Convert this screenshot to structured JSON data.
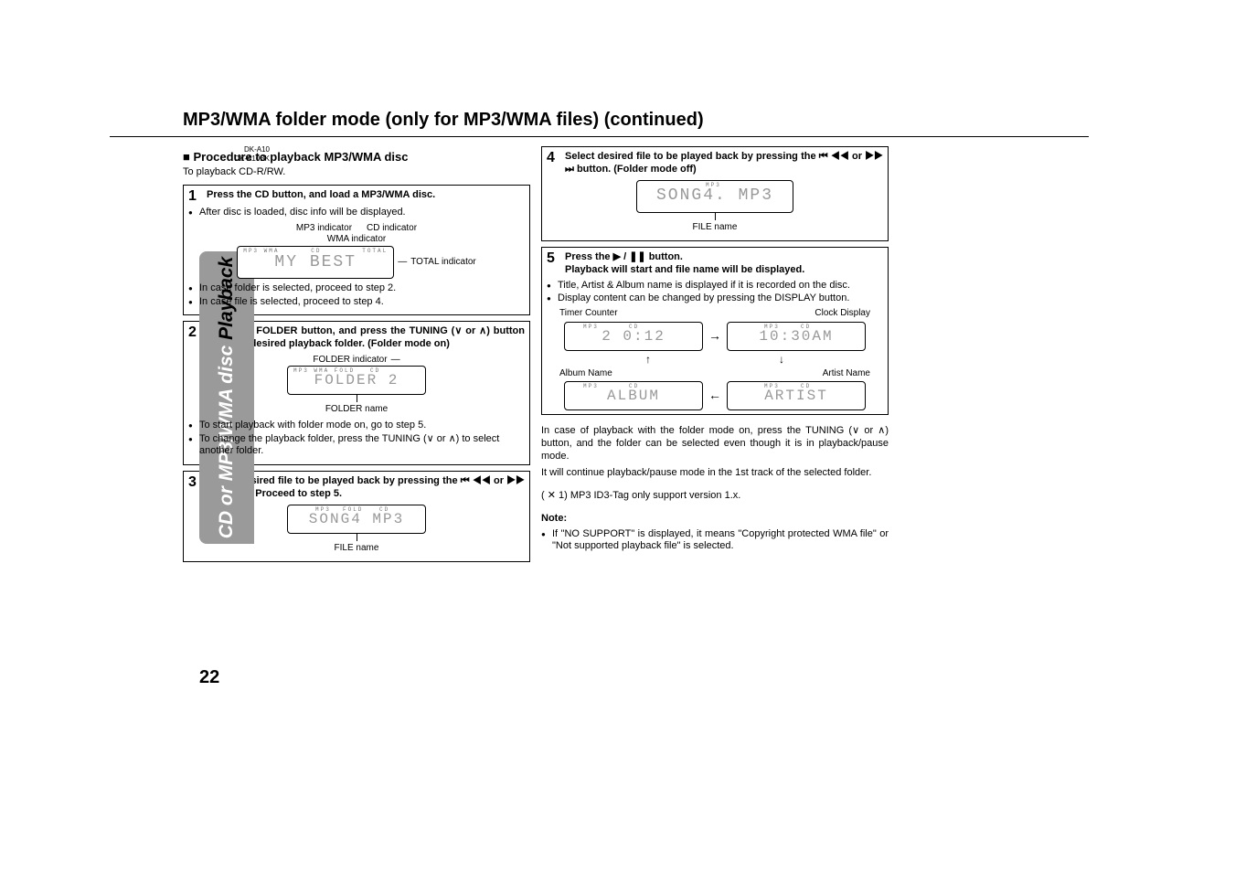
{
  "model": {
    "line1": "DK-A10",
    "line2": "DK-A10BK"
  },
  "title": "MP3/WMA folder mode (only for MP3/WMA files) (continued)",
  "tab": {
    "white": "CD or MP3/WMA disc ",
    "dark": "Playback"
  },
  "pagenum": "22",
  "left": {
    "sub_h": "Procedure to playback MP3/WMA disc",
    "play_cdr": "To playback CD-R/RW.",
    "step1": {
      "num": "1",
      "title": "Press the CD button, and load a MP3/WMA disc.",
      "bul1": "After disc is loaded, disc info will be displayed.",
      "ind_mp3": "MP3 indicator",
      "ind_cd": "CD indicator",
      "ind_wma": "WMA indicator",
      "ind_total": "TOTAL indicator",
      "lcd": "MY  BEST",
      "bul2": "In case folder is selected, proceed to step 2.",
      "bul3": "In case file is selected, proceed to step 4."
    },
    "step2": {
      "num": "2",
      "title": "Press the FOLDER button, and press the TUNING (∨ or ∧) button to select desired playback folder. (Folder mode on)",
      "fld_ind": "FOLDER indicator",
      "lcd": "FOLDER   2",
      "fld_name": "FOLDER name",
      "bul1": "To start playback with folder mode on, go to step 5.",
      "bul2": "To change the playback folder, press the TUNING (∨ or ∧) to select another folder."
    },
    "step3": {
      "num": "3",
      "title": "Select desired file to be played back by pressing the ⏮ ◀◀ or ▶▶ ⏭ button. Proceed to step 5.",
      "lcd": "SONG4  MP3",
      "file_name": "FILE name"
    }
  },
  "right": {
    "step4": {
      "num": "4",
      "title": "Select desired file to be played back by pressing the ⏮ ◀◀ or ▶▶ ⏭ button. (Folder mode off)",
      "lcd": "SONG4. MP3",
      "file_name": "FILE name"
    },
    "step5": {
      "num": "5",
      "title1": "Press the ▶ / ❚❚ button.",
      "title2": "Playback will start and file name will be displayed.",
      "bul1": "Title, Artist & Album name is displayed if it is recorded on the disc.",
      "bul2": "Display content can be changed by pressing the DISPLAY button.",
      "lbl_timer": "Timer Counter",
      "lbl_clock": "Clock Display",
      "lcd_timer": "2    0:12",
      "lcd_clock": "10:30AM",
      "lbl_album": "Album Name",
      "lbl_artist": "Artist Name",
      "lcd_album": "ALBUM",
      "lcd_artist": "ARTIST"
    },
    "para1": "In case of playback with the folder mode on, press the TUNING (∨ or ∧) button, and the folder can be selected even though it is in playback/pause mode.",
    "para2": "It will continue playback/pause mode in the 1st track of the selected folder.",
    "para3": "( ✕ 1) MP3 ID3-Tag only support version 1.x.",
    "note_h": "Note:",
    "note_b": "If \"NO SUPPORT\" is displayed, it means \"Copyright protected WMA file\" or \"Not supported playback file\" is selected."
  }
}
